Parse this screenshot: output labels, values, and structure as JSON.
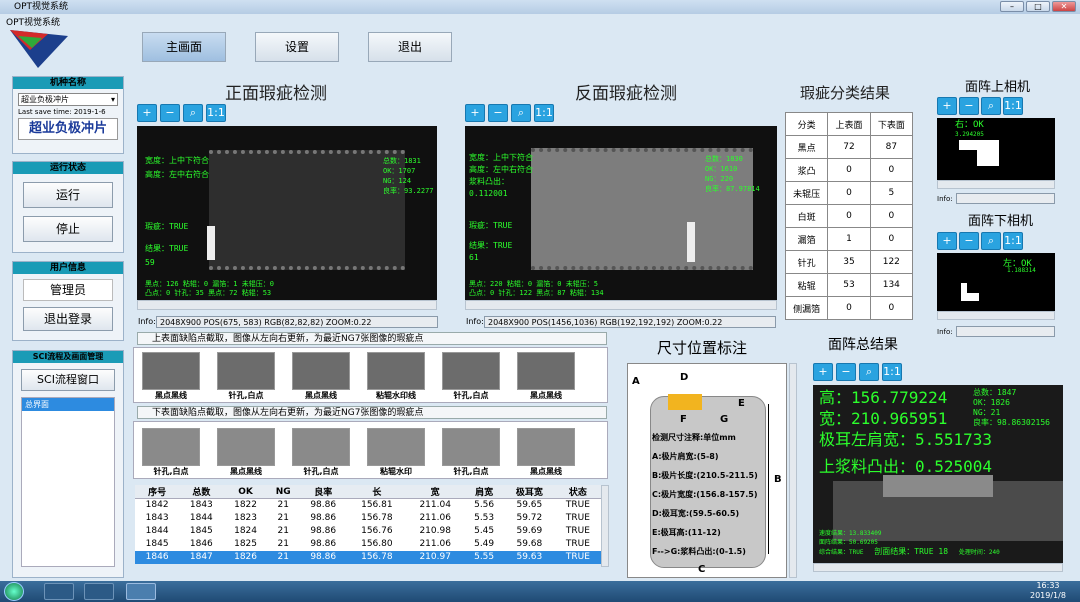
{
  "window": {
    "title": "OPT视觉系统",
    "subtitle": "OPT视觉系统"
  },
  "nav": {
    "main": "主画面",
    "settings": "设置",
    "exit": "退出"
  },
  "model": {
    "header": "机种名称",
    "select": "超业负极冲片",
    "saved": "Last save time: 2019-1-6",
    "name": "超业负极冲片"
  },
  "run": {
    "header": "运行状态",
    "start": "运行",
    "stop": "停止"
  },
  "user": {
    "header": "用户信息",
    "role": "管理员",
    "logout": "退出登录"
  },
  "sci": {
    "header": "SCI流程及画面管理",
    "button": "SCI流程窗口",
    "item": "总界面"
  },
  "front": {
    "title": "正面瑕疵检测",
    "ov": {
      "l1": "宽度：上中下符合",
      "l2": "高度：左中右符合",
      "l3": "瑕疵：TRUE",
      "l4": "结果：TRUE",
      "l5": "59",
      "r1": "总数：1831",
      "r2": "OK：1707",
      "r3": "NG：124",
      "r4": "良率：93.2277",
      "b1": "黑点：126 粘辊：0 漏箔：1 未辊压：0",
      "b2": "凸点：0 针孔：35 黑点：72 粘辊：53"
    },
    "info_label": "Info:",
    "info": "2048X900  POS(675, 583)  RGB(82,82,82)  ZOOM:0.22"
  },
  "back": {
    "title": "反面瑕疵检测",
    "ov": {
      "l1": "宽度：上中下符合",
      "l2": "高度：左中右符合",
      "l3": "浆料凸出：",
      "l3v": "0.112001",
      "l4": "瑕疵：TRUE",
      "l5": "结果：TRUE",
      "l6": "61",
      "r1": "总数：1830",
      "r2": "OK：1610",
      "r3": "NG：220",
      "r4": "良率：87.97814",
      "b1": "黑点：220 粘辊：0 漏箔：0 未辊压：5",
      "b2": "凸点：0 针孔：122 黑点：87 粘辊：134"
    },
    "info_label": "Info:",
    "info": "2048X900  POS(1456,1036)  RGB(192,192,192)  ZOOM:0.22"
  },
  "defect": {
    "title": "瑕疵分类结果",
    "headers": [
      "分类",
      "上表面",
      "下表面"
    ],
    "rows": [
      [
        "黑点",
        "72",
        "87"
      ],
      [
        "浆凸",
        "0",
        "0"
      ],
      [
        "未辊压",
        "0",
        "5"
      ],
      [
        "白斑",
        "0",
        "0"
      ],
      [
        "漏箔",
        "1",
        "0"
      ],
      [
        "针孔",
        "35",
        "122"
      ],
      [
        "粘辊",
        "53",
        "134"
      ],
      [
        "侧漏箔",
        "0",
        "0"
      ]
    ]
  },
  "upper_cam": {
    "title": "面阵上相机",
    "text": "右：OK",
    "val": "3.294205",
    "info_label": "Info:"
  },
  "lower_cam": {
    "title": "面阵下相机",
    "text": "左：OK",
    "val": "1.188314",
    "info_label": "Info:"
  },
  "strip1": {
    "banner": "上表面缺陷点截取，图像从左向右更新，为最近NG7张图像的瑕疵点",
    "items": [
      "黑点黑线",
      "针孔,白点",
      "黑点黑线",
      "粘辊水印线",
      "针孔,白点",
      "黑点黑线"
    ]
  },
  "strip2": {
    "banner": "下表面缺陷点截取，图像从左向右更新，为最近NG7张图像的瑕疵点",
    "items": [
      "针孔,白点",
      "黑点黑线",
      "针孔,白点",
      "粘辊水印",
      "针孔,白点",
      "黑点黑线"
    ]
  },
  "log": {
    "headers": [
      "序号",
      "总数",
      "OK",
      "NG",
      "良率",
      "长",
      "宽",
      "肩宽",
      "极耳宽",
      "状态"
    ],
    "rows": [
      [
        "1842",
        "1843",
        "1822",
        "21",
        "98.86",
        "156.81",
        "211.04",
        "5.56",
        "59.65",
        "TRUE"
      ],
      [
        "1843",
        "1844",
        "1823",
        "21",
        "98.86",
        "156.78",
        "211.06",
        "5.53",
        "59.72",
        "TRUE"
      ],
      [
        "1844",
        "1845",
        "1824",
        "21",
        "98.86",
        "156.76",
        "210.98",
        "5.45",
        "59.69",
        "TRUE"
      ],
      [
        "1845",
        "1846",
        "1825",
        "21",
        "98.86",
        "156.80",
        "211.06",
        "5.49",
        "59.68",
        "TRUE"
      ],
      [
        "1846",
        "1847",
        "1826",
        "21",
        "98.86",
        "156.78",
        "210.97",
        "5.55",
        "59.63",
        "TRUE"
      ]
    ]
  },
  "dim": {
    "title": "尺寸位置标注",
    "labels": {
      "A": "A",
      "B": "B",
      "C": "C",
      "D": "D",
      "E": "E",
      "F": "F",
      "G": "G"
    },
    "lines": [
      "检测尺寸注释:单位mm",
      "A:极片肩宽:(5-8)",
      "B:极片长度:(210.5-211.5)",
      "C:极片宽度:(156.8-157.5)",
      "D:极耳宽:(59.5-60.5)",
      "E:极耳高:(11-12)",
      "F-->G:浆料凸出:(0-1.5)"
    ]
  },
  "area": {
    "title": "面阵总结果",
    "l1": "高：156.779224",
    "l2": "宽：210.965951",
    "l3": "极耳左肩宽：5.551733",
    "l4": "上浆料凸出：0.525004",
    "r1": "总数：1847",
    "r2": "OK：1826",
    "r3": "NG：21",
    "r4": "良率：98.86302156",
    "b1": "速度结果：13.833409",
    "b2": "面阵结果：50.69205",
    "b3": "综合结果：TRUE",
    "b4": "剖面结果：TRUE  18",
    "b5": "处理时间：240"
  },
  "taskbar": {
    "time": "16:33",
    "date": "2019/1/8"
  },
  "colors": {
    "accent": "#1a9bb6",
    "green": "#2cff2c"
  }
}
